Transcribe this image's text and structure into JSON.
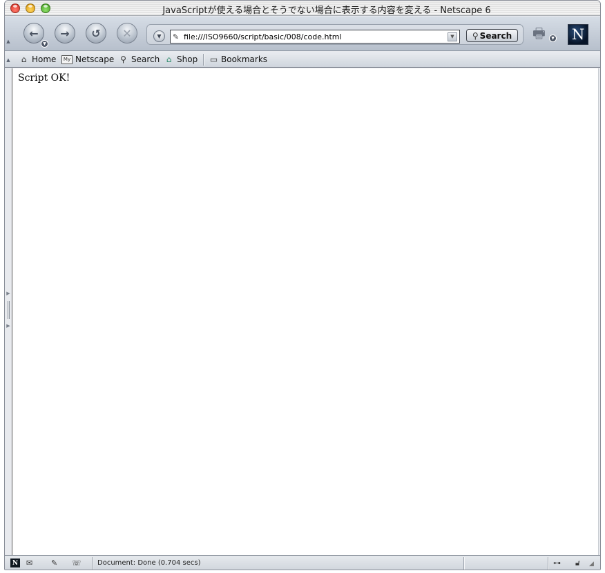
{
  "window": {
    "title": "JavaScriptが使える場合とそうでない場合に表示する内容を変える - Netscape 6"
  },
  "navigation": {
    "url": "file:///ISO9660/script/basic/008/code.html",
    "search_label": "Search",
    "buttons": [
      "back",
      "forward",
      "reload",
      "stop"
    ],
    "logo_letter": "N"
  },
  "personal_toolbar": {
    "items": [
      {
        "label": "Home",
        "icon": "home-icon"
      },
      {
        "label": "Netscape",
        "icon": "my-netscape-icon",
        "icon_text": "My"
      },
      {
        "label": "Search",
        "icon": "search-icon"
      },
      {
        "label": "Shop",
        "icon": "shop-icon"
      },
      {
        "label": "Bookmarks",
        "icon": "bookmarks-folder-icon"
      }
    ]
  },
  "page": {
    "body_text": "Script OK!"
  },
  "status": {
    "text": "Document: Done (0.704 secs)",
    "logo_letter": "N"
  }
}
